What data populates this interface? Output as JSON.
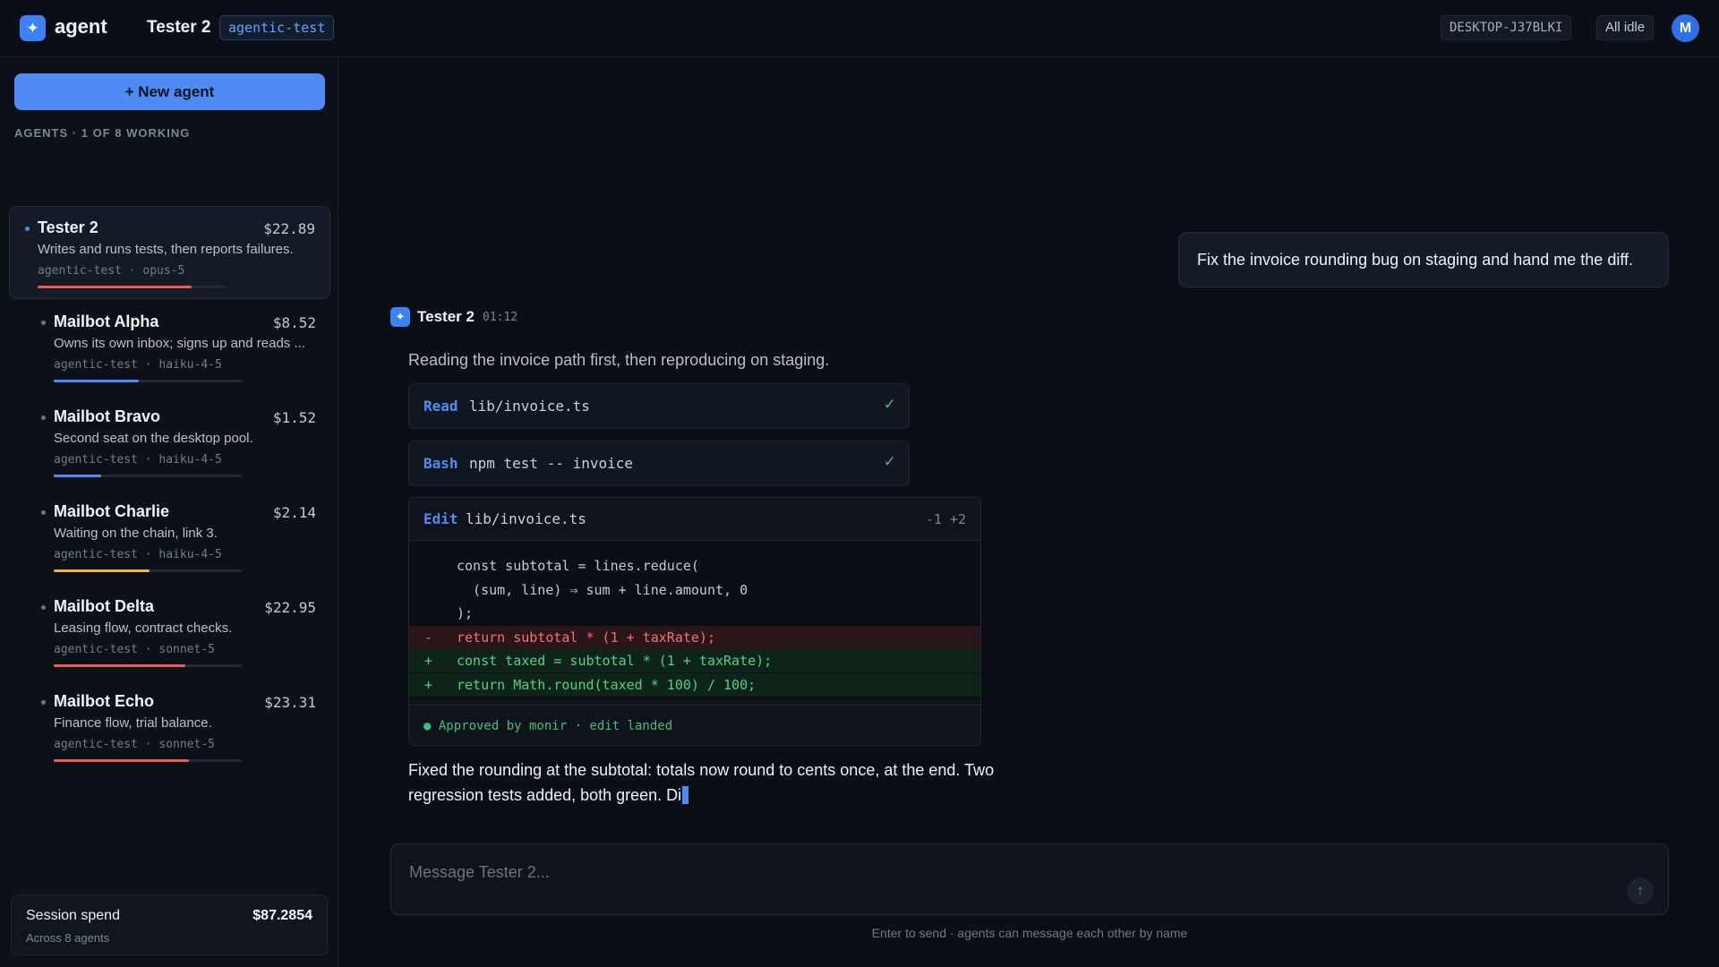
{
  "app": {
    "name": "agent",
    "logo_icon": "✦"
  },
  "header": {
    "agent_title": "Tester 2",
    "agent_tag": "agentic-test",
    "host": "DESKTOP-J37BLKI",
    "status": "All idle",
    "avatar_initial": "M"
  },
  "sidebar": {
    "new_agent_label": "+ New agent",
    "section_label": "AGENTS · 1 OF 8 WORKING",
    "agents": [
      {
        "name": "Tester 2",
        "cost": "$22.89",
        "desc": "Writes and runs tests, then reports failures.",
        "meta": "agentic-test · opus-5",
        "progress": 0.82,
        "color": "#ef5b5b",
        "active": true
      },
      {
        "name": "Mailbot Alpha",
        "cost": "$8.52",
        "desc": "Owns its own inbox; signs up and reads ...",
        "meta": "agentic-test · haiku-4-5",
        "progress": 0.45,
        "color": "#4f8bf5"
      },
      {
        "name": "Mailbot Bravo",
        "cost": "$1.52",
        "desc": "Second seat on the desktop pool.",
        "meta": "agentic-test · haiku-4-5",
        "progress": 0.25,
        "color": "#4f8bf5"
      },
      {
        "name": "Mailbot Charlie",
        "cost": "$2.14",
        "desc": "Waiting on the chain, link 3.",
        "meta": "agentic-test · haiku-4-5",
        "progress": 0.51,
        "color": "#f2b233"
      },
      {
        "name": "Mailbot Delta",
        "cost": "$22.95",
        "desc": "Leasing flow, contract checks.",
        "meta": "agentic-test · sonnet-5",
        "progress": 0.7,
        "color": "#ef5b5b"
      },
      {
        "name": "Mailbot Echo",
        "cost": "$23.31",
        "desc": "Finance flow, trial balance.",
        "meta": "agentic-test · sonnet-5",
        "progress": 0.72,
        "color": "#ef5b5b"
      }
    ],
    "session": {
      "title": "Session spend",
      "value": "$87.2854",
      "sub": "Across 8 agents"
    }
  },
  "chat": {
    "user_message": "Fix the invoice rounding bug on staging and hand me the diff.",
    "response": {
      "author": "Tester 2",
      "time": "01:12",
      "intro": "Reading the invoice path first, then reproducing on staging.",
      "tools": [
        {
          "verb": "Read",
          "arg": "lib/invoice.ts",
          "status": "✓"
        },
        {
          "verb": "Bash",
          "arg": "npm test -- invoice",
          "status": "✓"
        }
      ],
      "edit": {
        "verb": "Edit",
        "file": "lib/invoice.ts",
        "stat": "-1 +2",
        "lines": [
          {
            "kind": "ctx",
            "mark": "",
            "text": "const subtotal = lines.reduce("
          },
          {
            "kind": "ctx",
            "mark": "",
            "text": "  (sum, line) ⇒ sum + line.amount, 0"
          },
          {
            "kind": "ctx",
            "mark": "",
            "text": ");"
          },
          {
            "kind": "del",
            "mark": "-",
            "text": "return subtotal * (1 + taxRate);"
          },
          {
            "kind": "add",
            "mark": "+",
            "text": "const taxed = subtotal * (1 + taxRate);"
          },
          {
            "kind": "add",
            "mark": "+",
            "text": "return Math.round(taxed * 100) / 100;"
          }
        ],
        "approval": "● Approved by monir · edit landed"
      },
      "final_text": "Fixed the rounding at the subtotal: totals now round to cents once, at the end. Two regression tests added, both green. Di"
    }
  },
  "composer": {
    "placeholder": "Message Tester 2...",
    "send_icon": "↑",
    "hint": "Enter to send · agents can message each other by name"
  }
}
